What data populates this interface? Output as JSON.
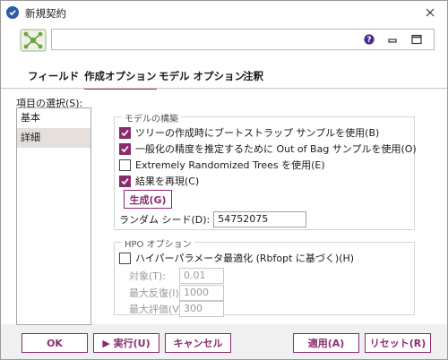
{
  "window": {
    "title": "新規契約"
  },
  "header": {
    "name_value": ""
  },
  "tabs": [
    {
      "label": "フィールド"
    },
    {
      "label": "作成オプション"
    },
    {
      "label": "モデル オプション"
    },
    {
      "label": "注釈"
    }
  ],
  "items_select": {
    "label": "項目の選択(S):",
    "items": [
      {
        "label": "基本"
      },
      {
        "label": "詳細"
      }
    ]
  },
  "model_build": {
    "title": "モデルの構築",
    "options": [
      {
        "label": "ツリーの作成時にブートストラップ サンプルを使用(B)",
        "checked": true
      },
      {
        "label": "一般化の精度を推定するために Out of Bag サンプルを使用(O)",
        "checked": true
      },
      {
        "label": "Extremely Randomized Trees を使用(E)",
        "checked": false
      },
      {
        "label": "結果を再現(C)",
        "checked": true
      }
    ],
    "generate_label": "生成(G)",
    "seed_label": "ランダム シード(D):",
    "seed_value": "54752075"
  },
  "hpo": {
    "title": "HPO オプション",
    "option_label": "ハイパーパラメータ最適化 (Rbfopt に基づく)(H)",
    "option_checked": false,
    "target_label": "対象(T):",
    "target_value": "0.01",
    "max_iter_label": "最大反復(I):",
    "max_iter_value": "1000",
    "max_eval_label": "最大評価(V):",
    "max_eval_value": "300"
  },
  "footer": {
    "ok": "OK",
    "run": "▶ 実行(U)",
    "cancel": "キャンセル",
    "apply": "適用(A)",
    "reset": "リセット(R)"
  },
  "colors": {
    "accent": "#8a2b6e",
    "selected_bg": "#e5e0db"
  },
  "icons": [
    "app-logo-icon",
    "close-icon",
    "help-icon",
    "minimize-icon",
    "maximize-icon",
    "random-trees-node-icon",
    "checkmark-icon"
  ]
}
